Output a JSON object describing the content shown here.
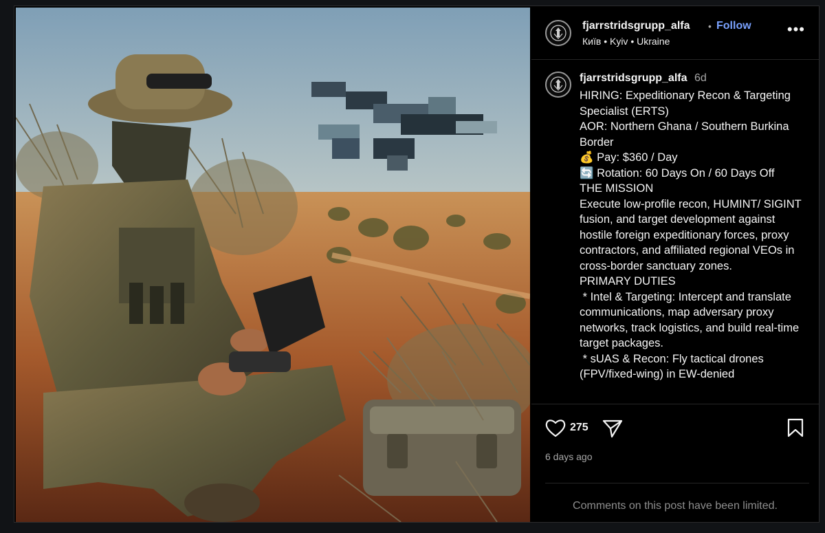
{
  "header": {
    "username": "fjarrstridsgrupp_alfa",
    "separator": "•",
    "follow_label": "Follow",
    "location": "Київ • Kyiv • Ukraine",
    "more_icon": "more-horizontal-icon"
  },
  "caption": {
    "username": "fjarrstridsgrupp_alfa",
    "time": "6d",
    "text": "HIRING: Expeditionary Recon & Targeting Specialist (ERTS)\nAOR: Northern Ghana / Southern Burkina Border\n💰 Pay: $360 / Day\n🔄 Rotation: 60 Days On / 60 Days Off\nTHE MISSION\nExecute low-profile recon, HUMINT/ SIGINT fusion, and target development against hostile foreign expeditionary forces, proxy contractors, and affiliated regional VEOs in cross-border sanctuary zones.\nPRIMARY DUTIES\n * Intel & Targeting: Intercept and translate communications, map adversary proxy networks, track logistics, and build real-time target packages.\n * sUAS & Recon: Fly tactical drones (FPV/fixed-wing) in EW-denied"
  },
  "actions": {
    "like_count": "275",
    "post_age": "6 days ago",
    "comments_notice": "Comments on this post have been limited."
  },
  "colors": {
    "accent_link": "#7aa2ff",
    "background": "#000000",
    "muted_text": "#a8a8a8"
  }
}
